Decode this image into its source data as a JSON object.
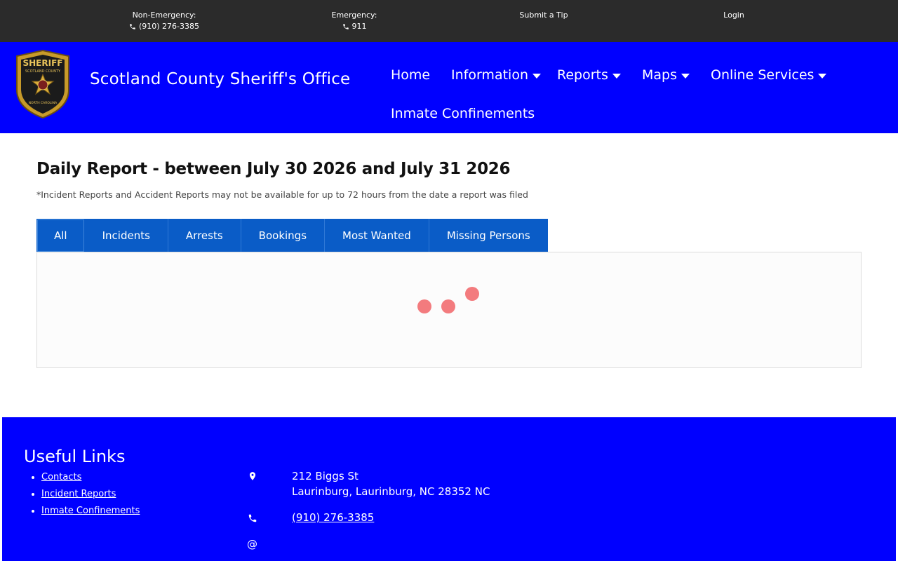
{
  "topbar": {
    "non_emergency_label": "Non-Emergency:",
    "non_emergency_phone": "(910) 276-3385",
    "emergency_label": "Emergency:",
    "emergency_phone": "911",
    "submit_tip": "Submit a Tip",
    "login": "Login",
    "icon": "phone-icon"
  },
  "header": {
    "logo_text_top": "SHERIFF",
    "logo_text_ring": "SCOTLAND COUNTY",
    "logo_text_bottom": "NORTH CAROLINA",
    "title": "Scotland County Sheriff's Office",
    "nav": [
      {
        "label": "Home",
        "dropdown": false
      },
      {
        "label": "Information",
        "dropdown": true
      },
      {
        "label": "Reports",
        "dropdown": true
      },
      {
        "label": "Maps",
        "dropdown": true
      },
      {
        "label": "Online Services",
        "dropdown": true
      },
      {
        "label": "Inmate Confinements",
        "dropdown": false
      }
    ],
    "background": "#0000ff"
  },
  "main": {
    "title": "Daily Report - between July 30 2026 and July 31 2026",
    "notice": "*Incident Reports and Accident Reports may not be available for up to 72 hours from the date a report was filed",
    "tabs": [
      {
        "label": "All",
        "active": true
      },
      {
        "label": "Incidents",
        "active": false
      },
      {
        "label": "Arrests",
        "active": false
      },
      {
        "label": "Bookings",
        "active": false
      },
      {
        "label": "Most Wanted",
        "active": false
      },
      {
        "label": "Missing Persons",
        "active": false
      }
    ],
    "loading_indicator": "loading-dots",
    "accent": "#0a5cc7",
    "loader_color": "#f37b7e"
  },
  "footer": {
    "title": "Useful Links",
    "links": [
      "Contacts",
      "Incident Reports",
      "Inmate Confinements"
    ],
    "address_line1": "212 Biggs St",
    "address_line2": "Laurinburg, Laurinburg, NC 28352 NC",
    "phone": "(910) 276-3385",
    "email_symbol": "@",
    "icons": [
      "map-pin-icon",
      "phone-icon",
      "at-icon"
    ]
  }
}
